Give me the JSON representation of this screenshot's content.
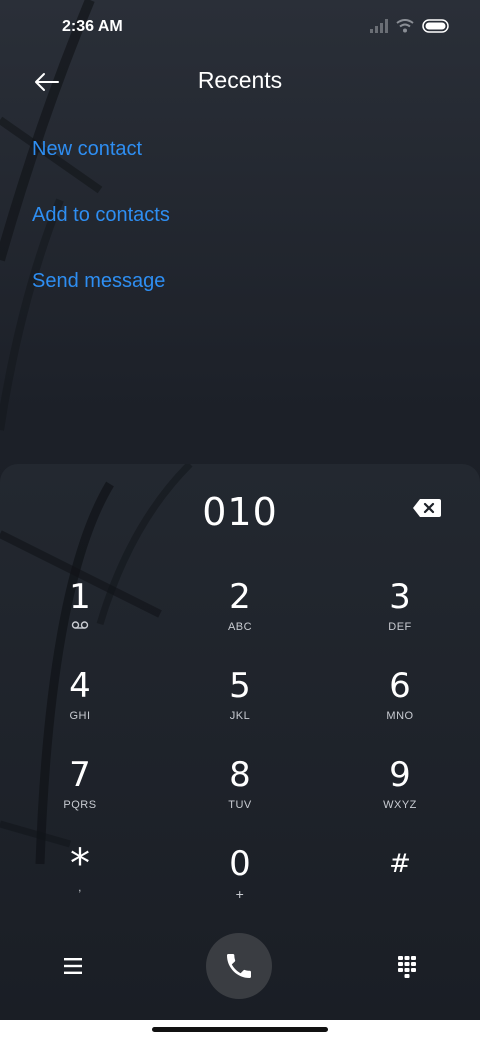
{
  "status_bar": {
    "time": "2:36 AM"
  },
  "header": {
    "title": "Recents"
  },
  "menu": [
    {
      "label": "New contact"
    },
    {
      "label": "Add to contacts"
    },
    {
      "label": "Send message"
    }
  ],
  "dialer": {
    "number": "010",
    "keys": [
      {
        "digit": "1",
        "letters": ""
      },
      {
        "digit": "2",
        "letters": "ABC"
      },
      {
        "digit": "3",
        "letters": "DEF"
      },
      {
        "digit": "4",
        "letters": "GHI"
      },
      {
        "digit": "5",
        "letters": "JKL"
      },
      {
        "digit": "6",
        "letters": "MNO"
      },
      {
        "digit": "7",
        "letters": "PQRS"
      },
      {
        "digit": "8",
        "letters": "TUV"
      },
      {
        "digit": "9",
        "letters": "WXYZ"
      },
      {
        "digit": "*",
        "letters": ","
      },
      {
        "digit": "0",
        "letters": "+"
      },
      {
        "digit": "#",
        "letters": ""
      }
    ]
  },
  "colors": {
    "accent": "#2e8ef2",
    "call_button": "#3a3d42"
  },
  "icons": [
    "back-arrow-icon",
    "signal-icon",
    "wifi-icon",
    "battery-icon",
    "backspace-icon",
    "voicemail-icon",
    "menu-icon",
    "phone-icon",
    "dialpad-grid-icon"
  ]
}
